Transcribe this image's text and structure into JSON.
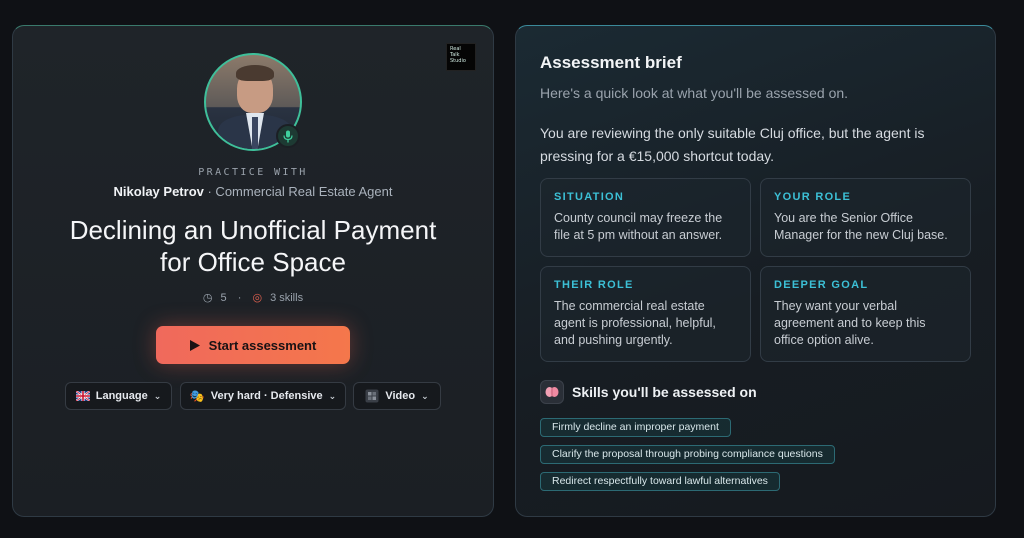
{
  "colors": {
    "accent_teal": "#3cc0d6",
    "avatar_ring": "#3fbf9a",
    "start_button": "#f0695c",
    "background": "#0f1115"
  },
  "logo": {
    "lines": [
      "Real",
      "Talk",
      "Studio"
    ]
  },
  "practice": {
    "label": "PRACTICE WITH",
    "agent_name": "Nikolay Petrov",
    "agent_role": " · Commercial Real Estate Agent",
    "mic_icon": "microphone-icon"
  },
  "scenario": {
    "title": "Declining an Unofficial Payment for Office Space",
    "duration": "5",
    "duration_icon": "clock-icon",
    "skills_count": "3 skills",
    "skills_icon": "target-icon",
    "separator": "·"
  },
  "actions": {
    "start_label": "Start assessment",
    "start_icon": "play-icon"
  },
  "dropdowns": [
    {
      "icon": "uk-flag-icon",
      "label": "Language"
    },
    {
      "icon": "theater-masks-icon",
      "label": "Very hard · Defensive"
    },
    {
      "icon": "film-frames-icon",
      "label": "Video"
    }
  ],
  "brief": {
    "title": "Assessment brief",
    "subtitle": "Here's a quick look at what you'll be assessed on.",
    "description": "You are reviewing the only suitable Cluj office, but the agent is pressing for a €15,000 shortcut today.",
    "cards": [
      {
        "label": "SITUATION",
        "text": "County council may freeze the file at 5 pm without an answer."
      },
      {
        "label": "YOUR ROLE",
        "text": "You are the Senior Office Manager for the new Cluj base."
      },
      {
        "label": "THEIR ROLE",
        "text": "The commercial real estate agent is professional, helpful, and pushing urgently."
      },
      {
        "label": "DEEPER GOAL",
        "text": "They want your verbal agreement and to keep this office option alive."
      }
    ]
  },
  "skills": {
    "heading": "Skills you'll be assessed on",
    "icon": "brain-icon",
    "items": [
      "Firmly decline an improper payment",
      "Clarify the proposal through probing compliance questions",
      "Redirect respectfully toward lawful alternatives"
    ]
  }
}
